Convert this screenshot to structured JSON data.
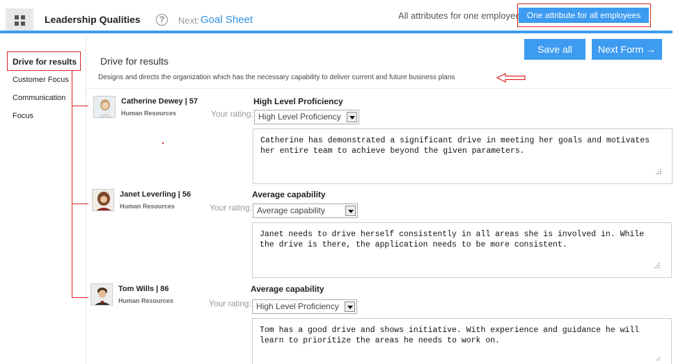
{
  "header": {
    "title": "Leadership Qualities",
    "next_label": "Next:",
    "next_link": "Goal Sheet",
    "mode_label": "All attributes for one employee",
    "mode_button": "One attribute for all employees",
    "help": "?"
  },
  "sidebar": {
    "items": [
      {
        "label": "Drive for results"
      },
      {
        "label": "Customer Focus"
      },
      {
        "label": "Communication"
      },
      {
        "label": "Focus"
      }
    ]
  },
  "actions": {
    "save": "Save all",
    "next_form": "Next Form →"
  },
  "section": {
    "title": "Drive for results",
    "description": "Designs and directs the organization which has the necessary capability to deliver current and future business plans"
  },
  "employees": [
    {
      "name": "Catherine Dewey | 57",
      "dept": "Human Resources",
      "rating_label": "Your rating:",
      "rating_title": "High Level Proficiency",
      "selected": "High Level Proficiency",
      "comment": "Catherine has demonstrated a significant drive in meeting her goals and motivates\nher entire team to achieve beyond the given parameters."
    },
    {
      "name": "Janet Leverling | 56",
      "dept": "Human Resources",
      "rating_label": "Your rating:",
      "rating_title": "Average capability",
      "selected": "Average capability",
      "comment": "Janet needs to drive herself consistently in all areas she is involved in. While\nthe drive is there, the application needs to be more consistent."
    },
    {
      "name": "Tom Wills | 86",
      "dept": "Human Resources",
      "rating_label": "Your rating:",
      "rating_title": "Average capability",
      "selected": "High Level Proficiency",
      "comment": "Tom has a good drive and shows initiative. With experience and guidance he will\nlearn to prioritize the areas he needs to work on."
    }
  ],
  "colors": {
    "accent": "#3d9bf0",
    "annotation": "#dd2222",
    "link": "#2b8fe0"
  }
}
